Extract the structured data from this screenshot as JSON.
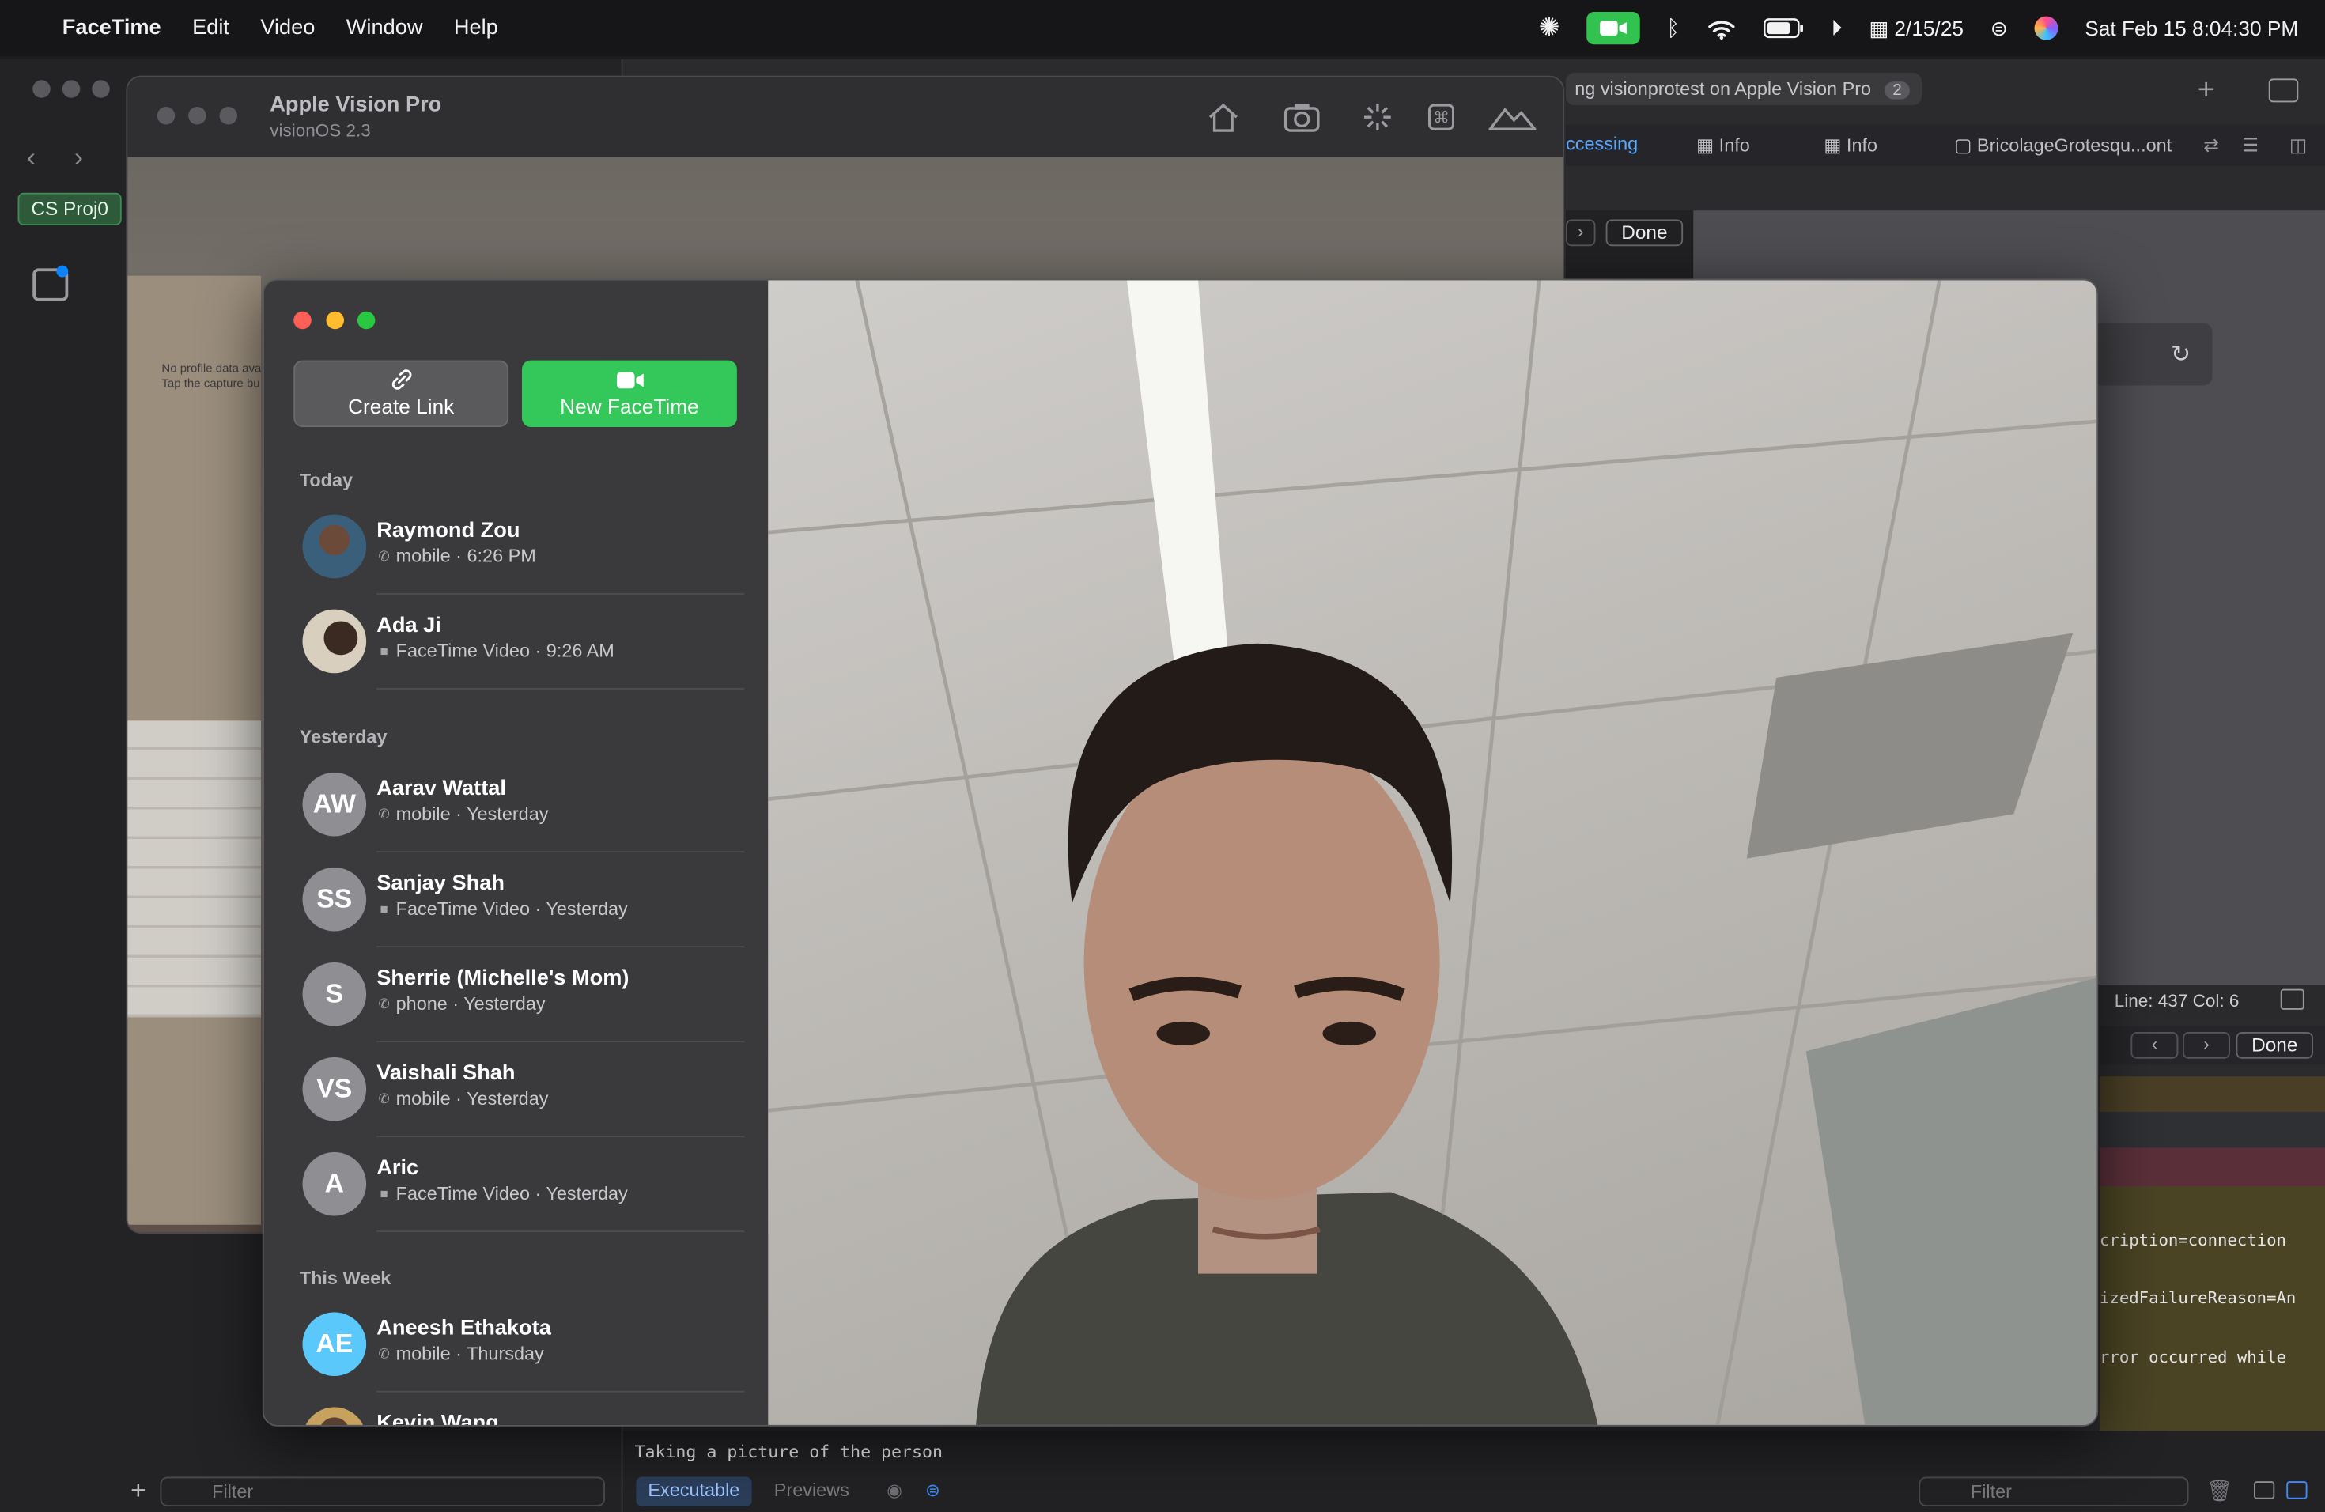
{
  "menubar": {
    "app_name": "FaceTime",
    "menus": [
      "Edit",
      "Video",
      "Window",
      "Help"
    ],
    "date_short": "2/15/25",
    "clock": "Sat Feb 15  8:04:30 PM"
  },
  "simulator": {
    "title": "Apple Vision Pro",
    "subtitle": "visionOS 2.3",
    "no_profile_text": "No profile data ava",
    "tap_text": "Tap the capture bu"
  },
  "xcode": {
    "project_badge": "CS Proj0",
    "scheme_text": "ng visionprotest on Apple Vision Pro",
    "scheme_count": "2",
    "tabs": [
      "ccessing",
      "Info",
      "Info",
      "BricolageGrotesqu...ont"
    ],
    "done_top": "Done",
    "line_col": "Line: 437  Col: 6",
    "done_bottom": "Done",
    "console_lines": [
      "cription=connection",
      "izedFailureReason=An",
      "rror occurred while"
    ],
    "console_message": "Taking a picture of the person",
    "tab_executable": "Executable",
    "tab_previews": "Previews",
    "filter_left": "Filter",
    "filter_right": "Filter"
  },
  "facetime": {
    "create_link": "Create Link",
    "new_facetime": "New FaceTime",
    "sections": {
      "today": "Today",
      "yesterday": "Yesterday",
      "this_week": "This Week"
    },
    "calls_today": [
      {
        "name": "Raymond Zou",
        "detail": "mobile · 6:26 PM",
        "kind": "phone",
        "initials": ""
      },
      {
        "name": "Ada Ji",
        "detail": "FaceTime Video · 9:26 AM",
        "kind": "video",
        "initials": ""
      }
    ],
    "calls_yesterday": [
      {
        "name": "Aarav Wattal",
        "detail": "mobile · Yesterday",
        "kind": "phone",
        "initials": "AW"
      },
      {
        "name": "Sanjay Shah",
        "detail": "FaceTime Video · Yesterday",
        "kind": "video",
        "initials": "SS"
      },
      {
        "name": "Sherrie (Michelle's Mom)",
        "detail": "phone · Yesterday",
        "kind": "phone",
        "initials": "S"
      },
      {
        "name": "Vaishali Shah",
        "detail": "mobile · Yesterday",
        "kind": "phone",
        "initials": "VS"
      },
      {
        "name": "Aric",
        "detail": "FaceTime Video · Yesterday",
        "kind": "video",
        "initials": "A"
      }
    ],
    "calls_this_week": [
      {
        "name": "Aneesh Ethakota",
        "detail": "mobile · Thursday",
        "kind": "phone",
        "initials": "AE"
      },
      {
        "name": "Kevin Wang",
        "detail": "",
        "kind": "phone",
        "initials": ""
      }
    ]
  },
  "colors": {
    "facetime_green": "#34c759",
    "accent_blue": "#0a84ff",
    "close_red": "#ff5f57",
    "minimize_yellow": "#febc2e",
    "zoom_green": "#28c840"
  },
  "icons": [
    "apple-logo-icon",
    "chatgpt-icon",
    "facetime-icon",
    "bluetooth-icon",
    "wifi-icon",
    "battery-icon",
    "play-icon",
    "calendar-icon",
    "control-center-icon",
    "siri-icon",
    "home-icon",
    "camera-icon",
    "spinner-icon",
    "command-icon",
    "mountains-icon",
    "link-icon",
    "video-camera-icon",
    "phone-icon",
    "refresh-icon",
    "plus-icon",
    "trash-icon"
  ]
}
